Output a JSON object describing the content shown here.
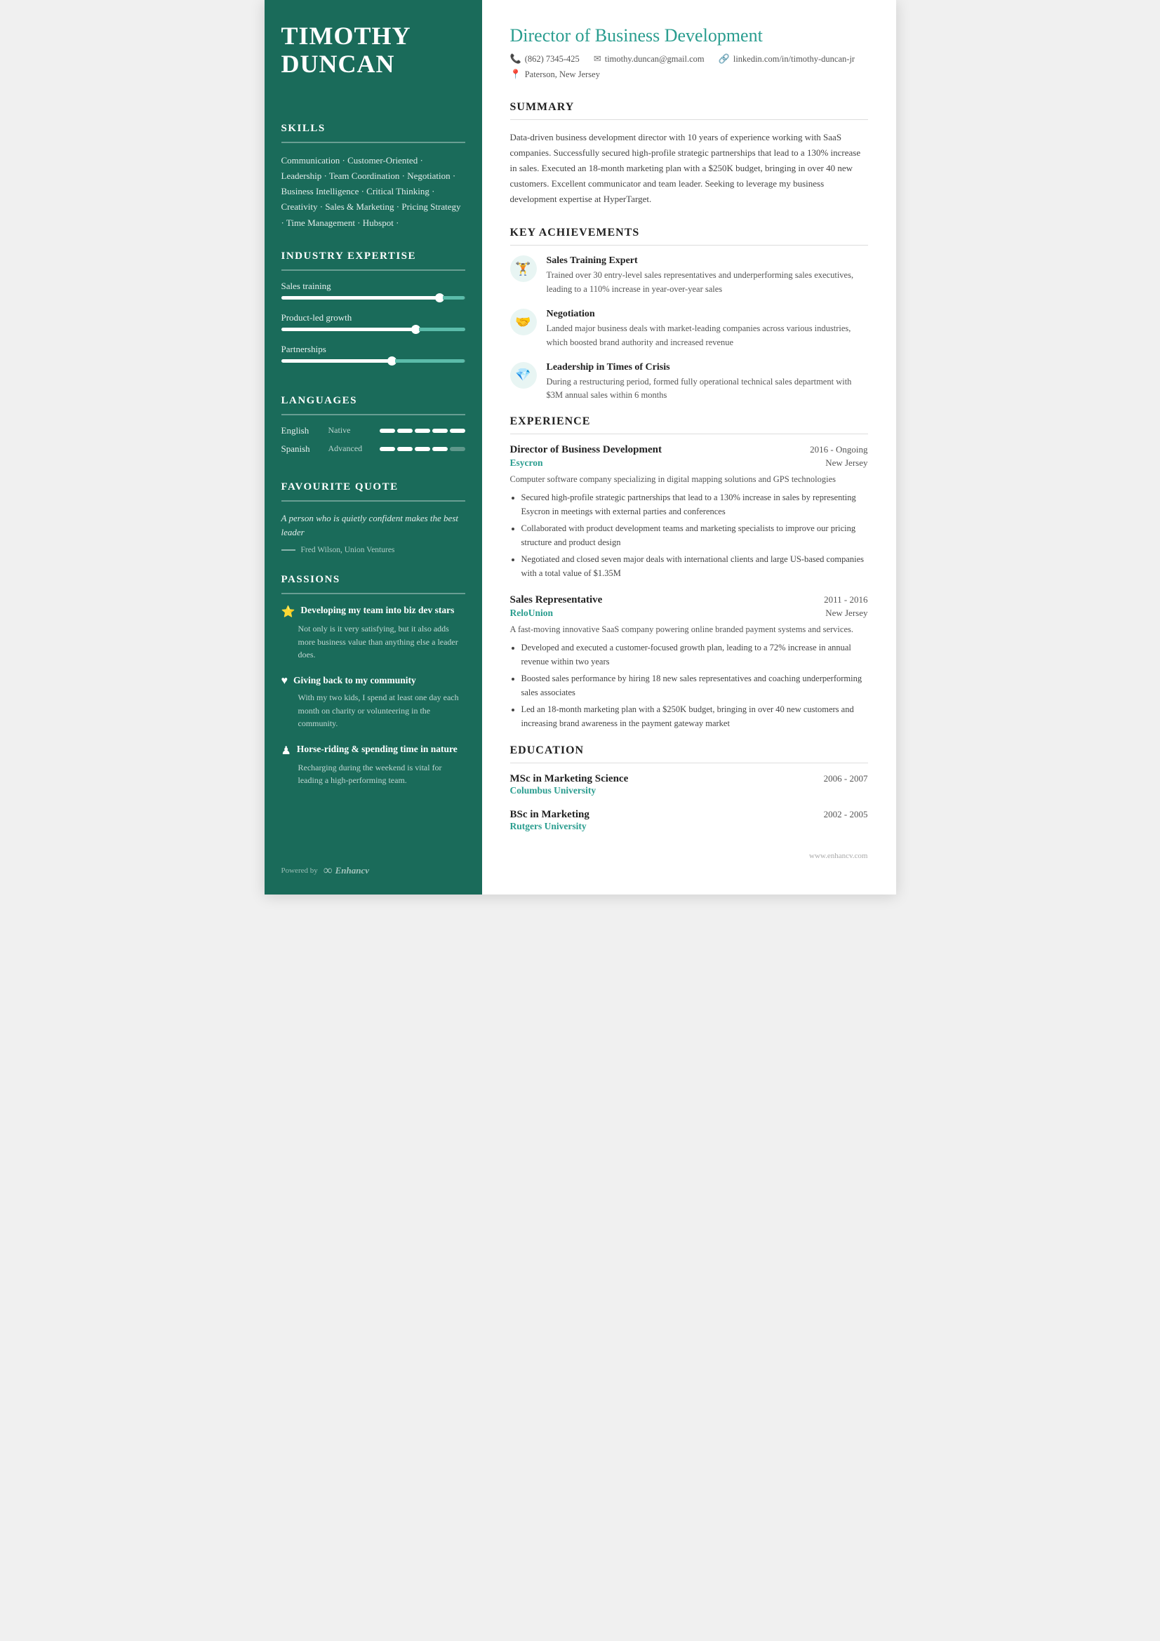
{
  "sidebar": {
    "name_line1": "TIMOTHY",
    "name_line2": "DUNCAN",
    "skills_title": "SKILLS",
    "skills_text": "Communication · Customer-Oriented · Leadership · Team Coordination · Negotiation · Business Intelligence · Critical Thinking · Creativity · Sales & Marketing · Pricing Strategy · Time Management · Hubspot ·",
    "expertise_title": "INDUSTRY EXPERTISE",
    "expertise_items": [
      {
        "label": "Sales training",
        "fill_pct": 88
      },
      {
        "label": "Product-led growth",
        "fill_pct": 75
      },
      {
        "label": "Partnerships",
        "fill_pct": 62
      }
    ],
    "languages_title": "LANGUAGES",
    "languages": [
      {
        "name": "English",
        "level": "Native",
        "active_segs": 5,
        "total_segs": 5
      },
      {
        "name": "Spanish",
        "level": "Advanced",
        "active_segs": 4,
        "total_segs": 5
      }
    ],
    "quote_title": "FAVOURITE QUOTE",
    "quote_text": "A person who is quietly confident makes the best leader",
    "quote_author": "Fred Wilson, Union Ventures",
    "passions_title": "PASSIONS",
    "passions": [
      {
        "icon": "⭐",
        "title": "Developing my team into biz dev stars",
        "desc": "Not only is it very satisfying, but it also adds more business value than anything else a leader does."
      },
      {
        "icon": "♥",
        "title": "Giving back to my community",
        "desc": "With my two kids, I spend at least one day each month on charity or volunteering in the community."
      },
      {
        "icon": "♟",
        "title": "Horse-riding & spending time in nature",
        "desc": "Recharging during the weekend is vital for leading a high-performing team."
      }
    ],
    "footer_powered": "Powered by",
    "footer_brand": "Enhancv"
  },
  "main": {
    "job_title": "Director of Business Development",
    "contact": {
      "phone": "(862) 7345-425",
      "email": "timothy.duncan@gmail.com",
      "linkedin": "linkedin.com/in/timothy-duncan-jr",
      "location": "Paterson, New Jersey"
    },
    "summary_title": "SUMMARY",
    "summary_text": "Data-driven business development director with 10 years of experience working with SaaS companies. Successfully secured high-profile strategic partnerships that lead to a 130% increase in sales. Executed an 18-month marketing plan with a $250K budget, bringing in over 40 new customers. Excellent communicator and team leader. Seeking to leverage my business development expertise at HyperTarget.",
    "achievements_title": "KEY ACHIEVEMENTS",
    "achievements": [
      {
        "icon": "🏋",
        "title": "Sales Training Expert",
        "desc": "Trained over 30 entry-level sales representatives and underperforming sales executives, leading to a 110% increase in year-over-year sales"
      },
      {
        "icon": "🤝",
        "title": "Negotiation",
        "desc": "Landed major business deals with market-leading companies across various industries, which boosted brand authority and increased revenue"
      },
      {
        "icon": "💎",
        "title": "Leadership in Times of Crisis",
        "desc": "During a restructuring period, formed fully operational technical sales department with $3M annual sales within 6 months"
      }
    ],
    "experience_title": "EXPERIENCE",
    "experiences": [
      {
        "title": "Director of Business Development",
        "dates": "2016 - Ongoing",
        "company": "Esycron",
        "location": "New Jersey",
        "desc": "Computer software company specializing in digital mapping solutions and GPS technologies",
        "bullets": [
          "Secured high-profile strategic partnerships that lead to a 130% increase in sales by representing Esycron in meetings with external parties and conferences",
          "Collaborated with product development teams and marketing specialists to improve our pricing structure and product design",
          "Negotiated and closed seven major deals with international clients and large US-based companies with a total value of $1.35M"
        ]
      },
      {
        "title": "Sales Representative",
        "dates": "2011 - 2016",
        "company": "ReloUnion",
        "location": "New Jersey",
        "desc": "A fast-moving innovative SaaS company powering online branded payment systems and services.",
        "bullets": [
          "Developed and executed a customer-focused growth plan, leading to a 72% increase in annual revenue within two years",
          "Boosted sales performance by hiring 18 new sales representatives and coaching underperforming sales associates",
          "Led an 18-month marketing plan with a $250K budget, bringing in over 40 new customers and increasing brand awareness in the payment gateway market"
        ]
      }
    ],
    "education_title": "EDUCATION",
    "education": [
      {
        "degree": "MSc in Marketing Science",
        "dates": "2006 - 2007",
        "school": "Columbus University"
      },
      {
        "degree": "BSc in Marketing",
        "dates": "2002 - 2005",
        "school": "Rutgers University"
      }
    ],
    "footer_url": "www.enhancv.com"
  }
}
